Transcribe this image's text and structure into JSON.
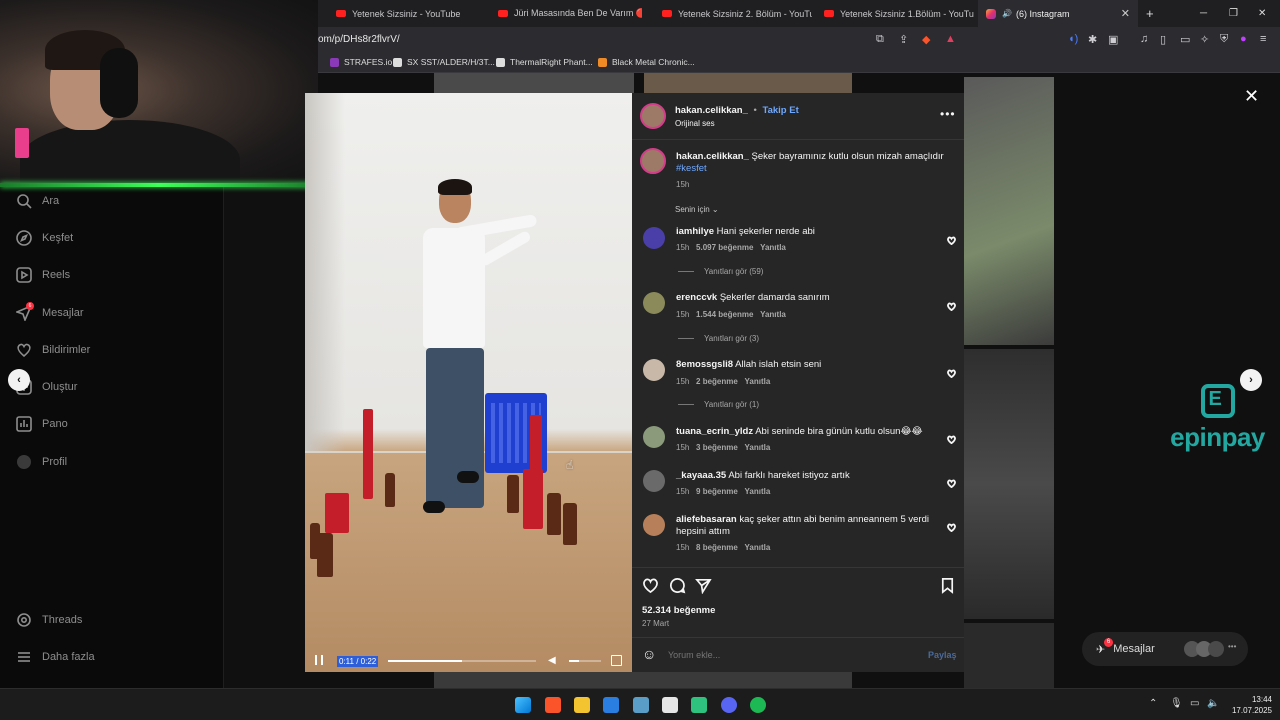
{
  "browser": {
    "tabs": [
      {
        "title": "Yetenek Sizsiniz - YouTube",
        "type": "youtube"
      },
      {
        "title": "Jüri Masasında Ben De Varım 🔴 | Yet",
        "type": "youtube"
      },
      {
        "title": "Yetenek Sizsiniz 2. Bölüm - YouTube",
        "type": "youtube"
      },
      {
        "title": "Yetenek Sizsiniz 1.Bölüm - YouTube",
        "type": "youtube"
      },
      {
        "title": "(6) Instagram",
        "type": "instagram",
        "active": true
      }
    ],
    "new_tab": "+",
    "url": "om/p/DHs8r2flvrV/",
    "bookmarks": [
      {
        "label": "STRAFES.io",
        "color": "#8a3ab9"
      },
      {
        "label": "SX SST/ALDER/H/3T...",
        "color": "#dddddd"
      },
      {
        "label": "ThermalRight Phant...",
        "color": "#dddddd"
      },
      {
        "label": "Black Metal Chronic...",
        "color": "#f08a24"
      }
    ]
  },
  "sidebar": {
    "items": [
      {
        "label": "Ara",
        "icon": "search-icon"
      },
      {
        "label": "Keşfet",
        "icon": "compass-icon"
      },
      {
        "label": "Reels",
        "icon": "reels-icon"
      },
      {
        "label": "Mesajlar",
        "icon": "messenger-icon",
        "badge": "6"
      },
      {
        "label": "Bildirimler",
        "icon": "heart-icon"
      },
      {
        "label": "Oluştur",
        "icon": "plus-icon"
      },
      {
        "label": "Pano",
        "icon": "chart-icon"
      },
      {
        "label": "Profil",
        "icon": "avatar-icon"
      }
    ],
    "bottom": [
      {
        "label": "Threads",
        "icon": "threads-icon"
      },
      {
        "label": "Daha fazla",
        "icon": "menu-icon"
      }
    ]
  },
  "video": {
    "time": "0:11 / 0:22",
    "progress": 0.5,
    "volume": 0.3
  },
  "post": {
    "author": "hakan.celikkan_",
    "follow_sep": "•",
    "follow": "Takip Et",
    "audio": "Orijinal ses",
    "caption_user": "hakan.celikkan_",
    "caption_text": "Şeker bayramınız kutlu olsun mizah amaçlıdır",
    "hashtag": "#kesfet",
    "caption_time": "15h",
    "filter_label": "Senin için",
    "comments": [
      {
        "user": "iamhilye",
        "text": "Hani şekerler nerde abi",
        "time": "15h",
        "likes": "5.097 beğenme",
        "reply": "Yanıtla",
        "replies": "Yanıtları gör (59)"
      },
      {
        "user": "erenccvk",
        "text": "Şekerler damarda sanırım",
        "time": "15h",
        "likes": "1.544 beğenme",
        "reply": "Yanıtla",
        "replies": "Yanıtları gör (3)"
      },
      {
        "user": "8emossgsli8",
        "text": "Allah islah etsin seni",
        "time": "15h",
        "likes": "2 beğenme",
        "reply": "Yanıtla",
        "replies": "Yanıtları gör (1)"
      },
      {
        "user": "tuana_ecrin_yldz",
        "text": "Abi seninde bira günün kutlu olsun😂😂",
        "time": "15h",
        "likes": "3 beğenme",
        "reply": "Yanıtla",
        "replies": ""
      },
      {
        "user": "_kayaaa.35",
        "text": "Abi farklı hareket istiyoz artık",
        "time": "15h",
        "likes": "9 beğenme",
        "reply": "Yanıtla",
        "replies": ""
      },
      {
        "user": "aliefebasaran",
        "text": "kaç şeker attın abi benim anneannem 5 verdi hepsini attım",
        "time": "15h",
        "likes": "8 beğenme",
        "reply": "Yanıtla",
        "replies": ""
      }
    ],
    "likes_total": "52.314 beğenme",
    "date": "27 Mart",
    "comment_placeholder": "Yorum ekle...",
    "share": "Paylaş"
  },
  "overlay": {
    "close": "✕",
    "ad_text": "epinpay",
    "messages_pill": "Mesajlar",
    "messages_badge": "6"
  },
  "taskbar": {
    "time": "13:44",
    "date": "17.07.2025"
  },
  "colors": {
    "instagram_link": "#6fa8ff",
    "panel_bg": "#262626",
    "epinpay": "#23a8a1"
  }
}
